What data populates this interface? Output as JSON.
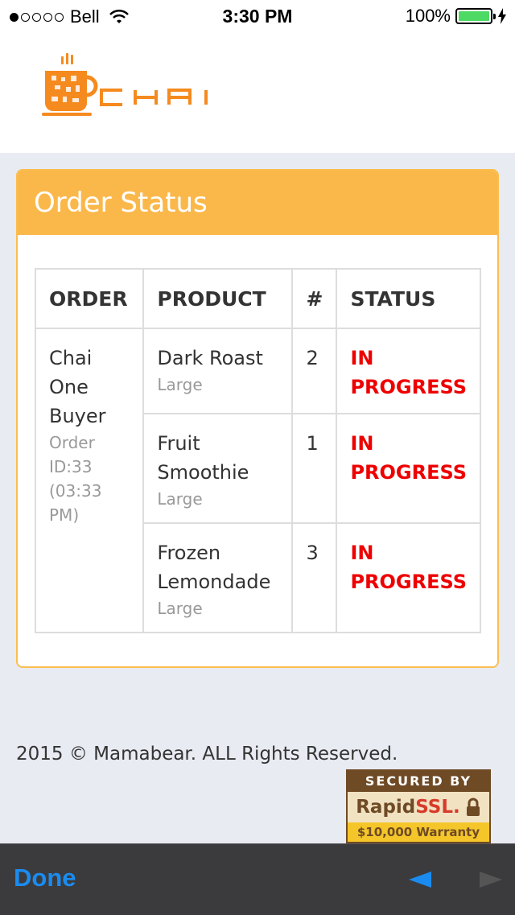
{
  "statusbar": {
    "carrier": "Bell",
    "time": "3:30 PM",
    "battery": "100%",
    "signal_bars": 1
  },
  "header": {
    "logo_text": "CHAI",
    "logo_color": "#f58a1f"
  },
  "panel": {
    "title": "Order Status",
    "accent": "#fbb84a"
  },
  "table": {
    "headers": [
      "ORDER",
      "PRODUCT",
      "#",
      "STATUS"
    ],
    "order": {
      "buyer": "Chai One Buyer",
      "meta": "Order ID:33 (03:33 PM)"
    },
    "rows": [
      {
        "product": "Dark Roast",
        "size": "Large",
        "qty": "2",
        "status": "IN PROGRESS"
      },
      {
        "product": "Fruit Smoothie",
        "size": "Large",
        "qty": "1",
        "status": "IN PROGRESS"
      },
      {
        "product": "Frozen Lemondade",
        "size": "Large",
        "qty": "3",
        "status": "IN PROGRESS"
      }
    ],
    "status_color": "#ee0000"
  },
  "footer": {
    "copyright": "2015 © Mamabear. ALL Rights Reserved.",
    "ssl_badge": {
      "top": "SECURED BY",
      "brand_a": "Rapid",
      "brand_b": "SSL.",
      "warranty": "$10,000 Warranty"
    }
  },
  "toolbar": {
    "done_label": "Done",
    "back_icon": "back-arrow-icon",
    "forward_icon": "forward-arrow-icon"
  }
}
